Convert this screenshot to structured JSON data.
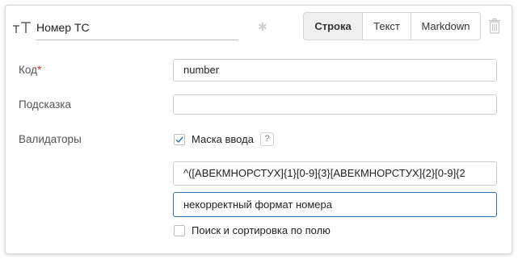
{
  "header": {
    "field_name": "Номер ТС",
    "type_tabs": [
      {
        "label": "Строка",
        "active": true
      },
      {
        "label": "Текст",
        "active": false
      },
      {
        "label": "Markdown",
        "active": false
      }
    ]
  },
  "form": {
    "code": {
      "label": "Код",
      "required_mark": "*",
      "value": "number"
    },
    "hint": {
      "label": "Подсказка",
      "value": ""
    },
    "validators": {
      "label": "Валидаторы",
      "mask": {
        "label": "Маска ввода",
        "checked": true,
        "help": "?"
      },
      "mask_pattern": "^([АВЕКМНОРСТУХ]{1}[0-9]{3}[АВЕКМНОРСТУХ]{2}[0-9]{2",
      "error_message": "некорректный формат номера"
    },
    "search_sort": {
      "label": "Поиск и сортировка по полю",
      "checked": false
    }
  },
  "icons": {
    "type": "text-type-icon",
    "asterisk": "asterisk-icon",
    "trash": "trash-icon"
  },
  "colors": {
    "required": "#e53935",
    "focus_border": "#2f6fb0",
    "active_tab_bg": "#efefef"
  }
}
